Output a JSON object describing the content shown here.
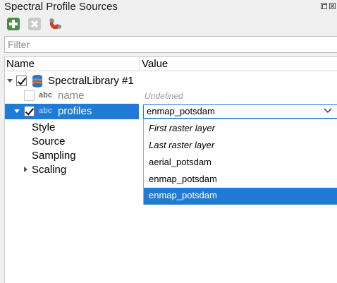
{
  "window": {
    "title": "Spectral Profile Sources"
  },
  "toolbar": {
    "add_icon": "add-icon",
    "remove_icon": "remove-icon",
    "magnet_icon": "magnet-icon"
  },
  "filter": {
    "placeholder": "Filter"
  },
  "tree": {
    "columns": {
      "name": "Name",
      "value": "Value"
    },
    "library": {
      "label": "SpectralLibrary #1",
      "checked": true
    },
    "name_field": {
      "type_badge": "abc",
      "label": "name",
      "value": "Undefined",
      "checked": false
    },
    "profiles_field": {
      "type_badge": "abc",
      "label": "profiles",
      "value": "enmap_potsdam",
      "checked": true
    },
    "children": [
      "Style",
      "Source",
      "Sampling",
      "Scaling"
    ]
  },
  "dropdown": {
    "options": [
      "First raster layer",
      "Last raster layer",
      "aerial_potsdam",
      "enmap_potsdam",
      "enmap_potsdam"
    ],
    "selected_index": 4
  },
  "colors": {
    "selection": "#1f7bd6",
    "add_green": "#3c8c3c"
  }
}
